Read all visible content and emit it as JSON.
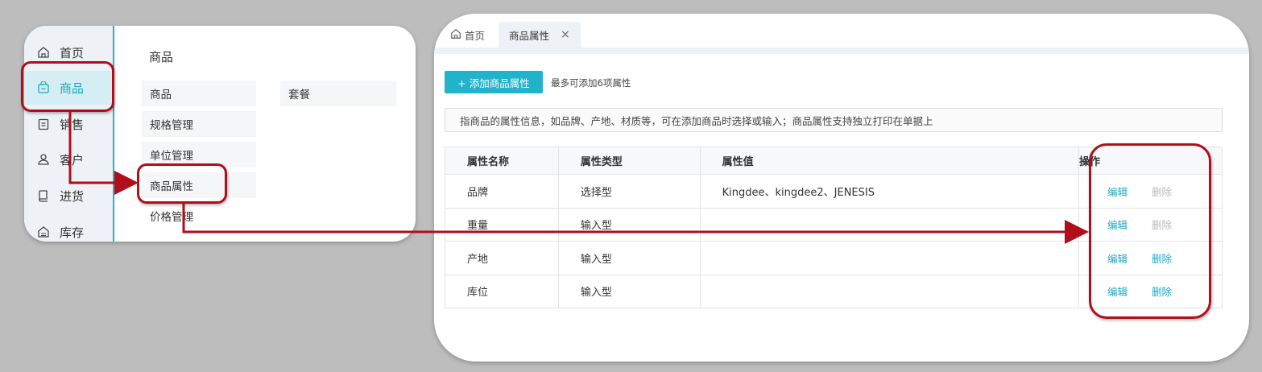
{
  "sidebar": {
    "items": [
      {
        "label": "首页",
        "icon": "home-icon"
      },
      {
        "label": "商品",
        "icon": "bag-icon",
        "active": true
      },
      {
        "label": "销售",
        "icon": "clipboard-icon"
      },
      {
        "label": "客户",
        "icon": "user-icon"
      },
      {
        "label": "进货",
        "icon": "book-icon"
      },
      {
        "label": "库存",
        "icon": "warehouse-icon"
      }
    ]
  },
  "submenu": {
    "title": "商品",
    "col1": [
      "商品",
      "规格管理",
      "单位管理",
      "商品属性",
      "价格管理"
    ],
    "col2": [
      "套餐"
    ]
  },
  "tabs": {
    "home_label": "首页",
    "active_label": "商品属性",
    "close_glyph": "×"
  },
  "toolbar": {
    "add_button_label": "+ 添加商品属性",
    "limit_hint": "最多可添加6项属性"
  },
  "info_text": "指商品的属性信息，如品牌、产地、材质等，可在添加商品时选择或输入；商品属性支持独立打印在单据上",
  "table": {
    "headers": [
      "属性名称",
      "属性类型",
      "属性值",
      "操作"
    ],
    "rows": [
      {
        "name": "品牌",
        "type": "选择型",
        "value": "Kingdee、kingdee2、JENESIS",
        "edit": "编辑",
        "delete": "删除",
        "delete_enabled": false
      },
      {
        "name": "重量",
        "type": "输入型",
        "value": "",
        "edit": "编辑",
        "delete": "删除",
        "delete_enabled": false
      },
      {
        "name": "产地",
        "type": "输入型",
        "value": "",
        "edit": "编辑",
        "delete": "删除",
        "delete_enabled": true
      },
      {
        "name": "库位",
        "type": "输入型",
        "value": "",
        "edit": "编辑",
        "delete": "删除",
        "delete_enabled": true
      }
    ]
  },
  "colors": {
    "accent": "#21b3c9",
    "highlight": "#b00e1a",
    "disabled": "#bbbbbb"
  }
}
